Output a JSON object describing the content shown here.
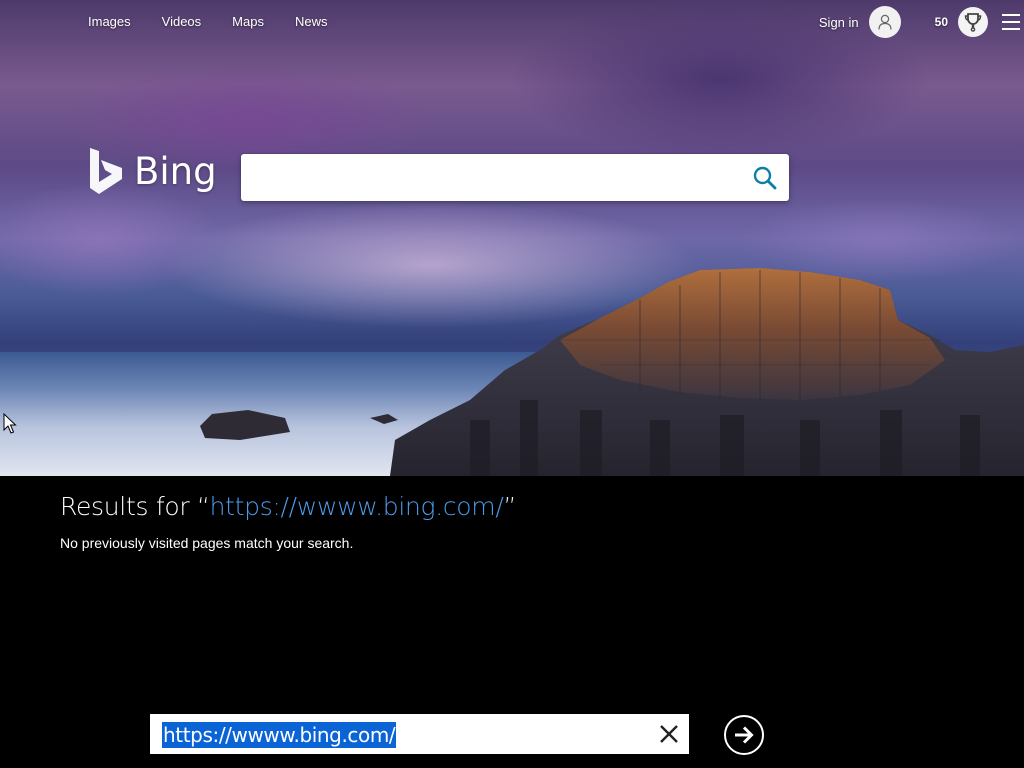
{
  "nav": {
    "items": [
      "Images",
      "Videos",
      "Maps",
      "News"
    ]
  },
  "account": {
    "signin_label": "Sign in",
    "points": "50"
  },
  "logo": {
    "text": "Bing"
  },
  "search": {
    "value": ""
  },
  "results": {
    "prefix": "Results for “",
    "query": "https://wwww.bing.com/",
    "suffix": "”",
    "message": "No previously visited pages match your search."
  },
  "addressbar": {
    "url": "https://wwww.bing.com/"
  },
  "colors": {
    "link_blue": "#4d9bea",
    "selection_blue": "#0a64d6"
  },
  "icons": [
    "user-icon",
    "rewards-trophy-icon",
    "hamburger-menu-icon",
    "search-icon",
    "bing-b-icon",
    "close-icon",
    "arrow-right-circle-icon",
    "mouse-pointer-icon"
  ]
}
